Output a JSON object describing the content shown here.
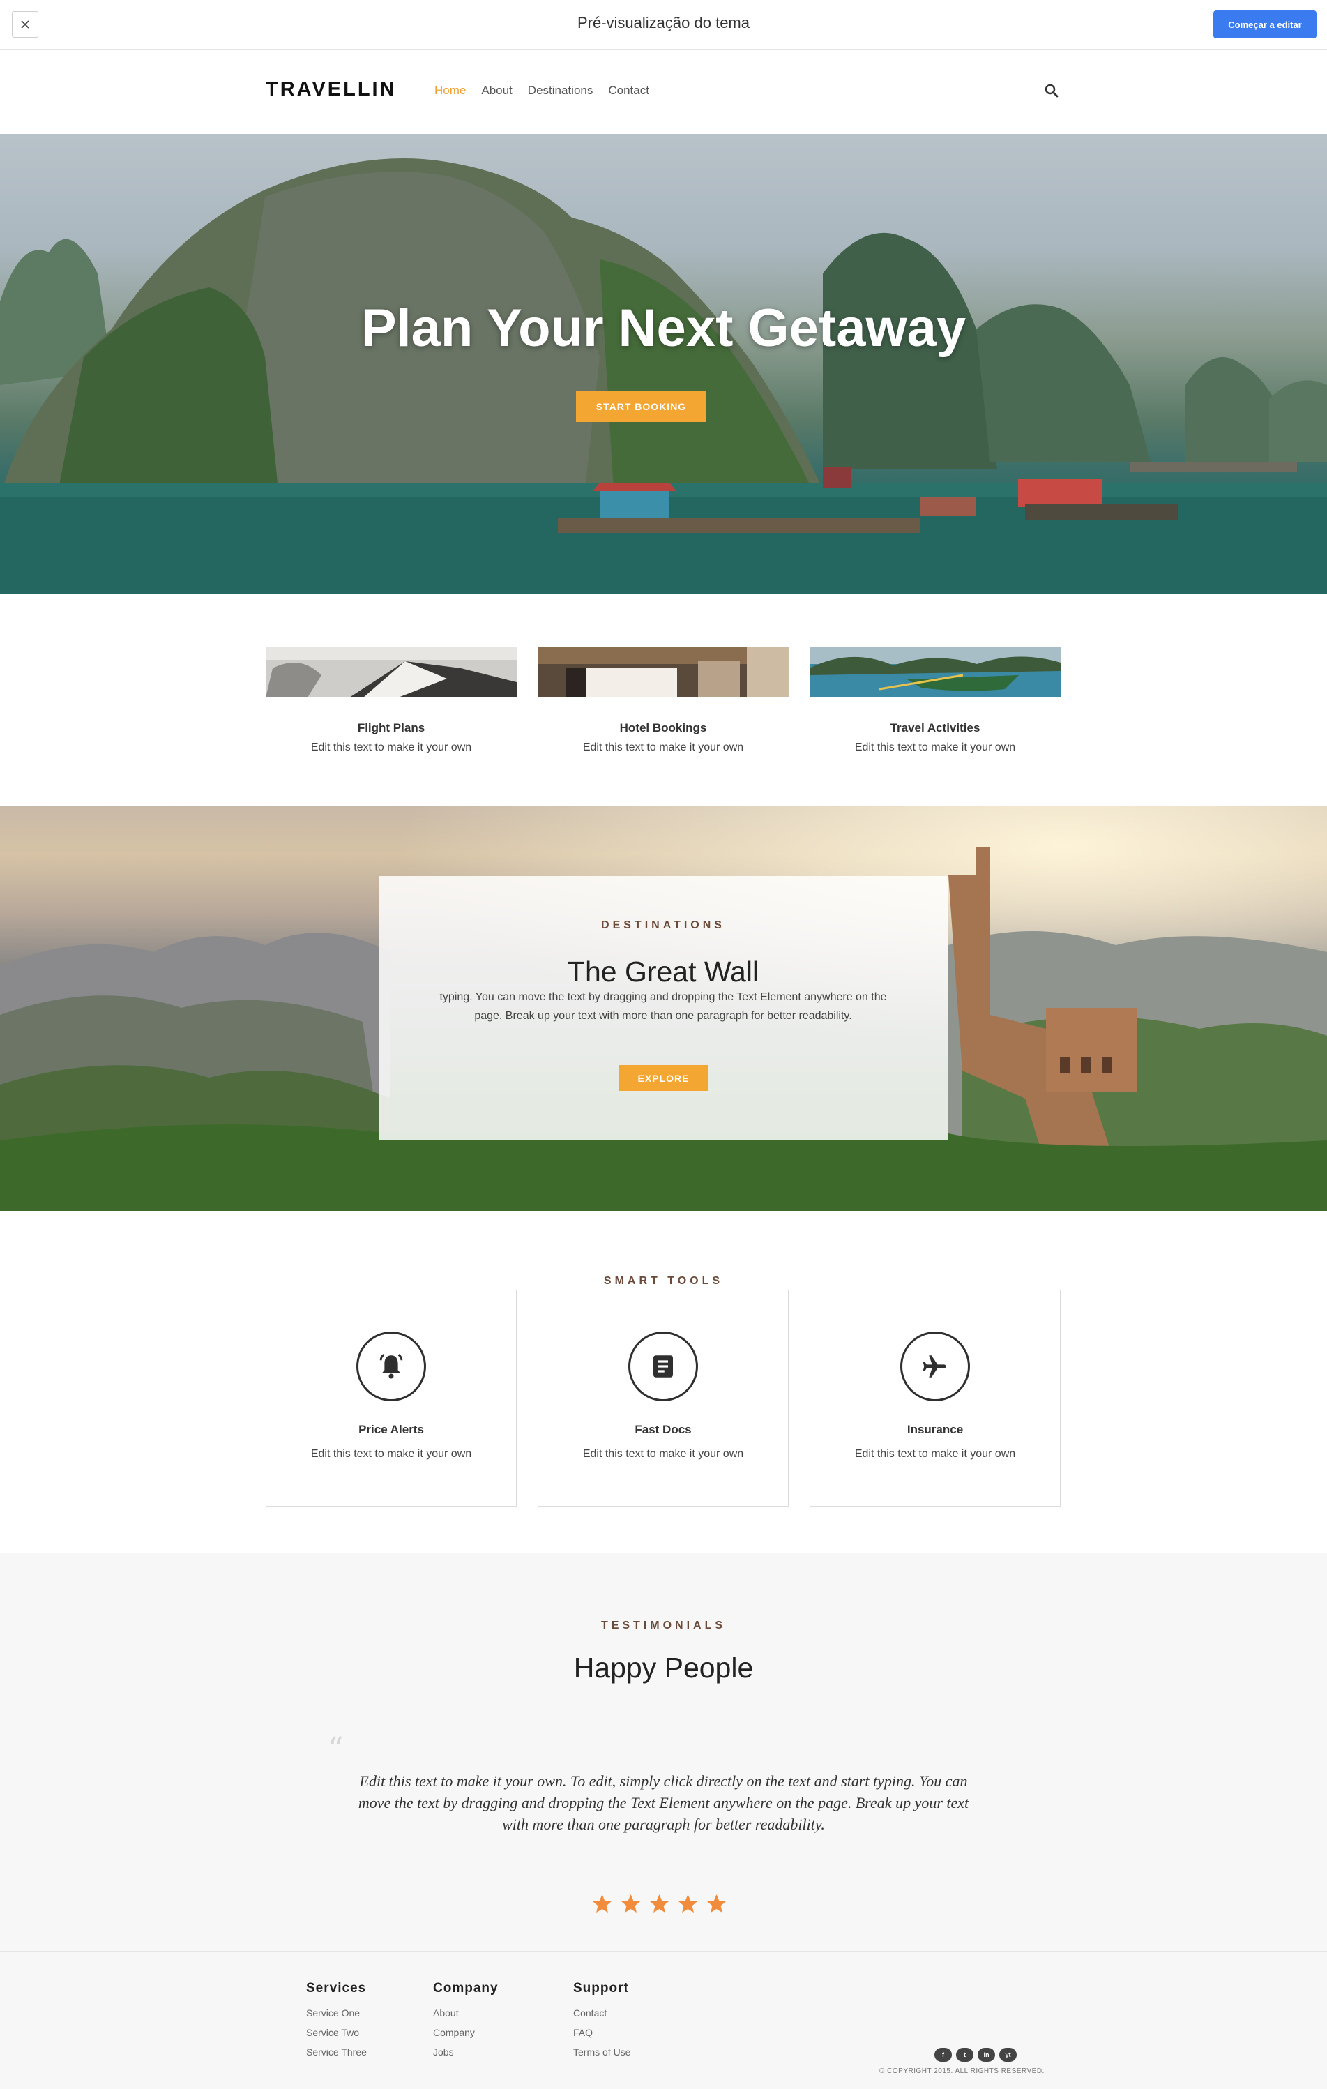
{
  "preview_bar": {
    "title": "Pré-visualização do tema",
    "edit_label": "Começar a editar",
    "close_icon": "close-icon"
  },
  "site": {
    "logo": "TRAVELLIN",
    "nav": [
      {
        "label": "Home",
        "active": true
      },
      {
        "label": "About",
        "active": false
      },
      {
        "label": "Destinations",
        "active": false
      },
      {
        "label": "Contact",
        "active": false
      }
    ],
    "search_icon": "search-icon",
    "accent_color": "#f4a632"
  },
  "hero": {
    "title": "Plan Your Next Getaway",
    "button": "START BOOKING"
  },
  "services": [
    {
      "title": "Flight Plans",
      "desc": "Edit this text to make it your own"
    },
    {
      "title": "Hotel Bookings",
      "desc": "Edit this text to make it your own"
    },
    {
      "title": "Travel Activities",
      "desc": "Edit this text to make it your own"
    }
  ],
  "destinations": {
    "eyebrow": "DESTINATIONS",
    "title": "The Great Wall",
    "text": "typing. You can move the text by dragging and dropping the Text Element anywhere on the page. Break up your text with more than one paragraph for better readability.",
    "button": "EXPLORE"
  },
  "tools": {
    "eyebrow": "SMART TOOLS",
    "items": [
      {
        "title": "Price Alerts",
        "desc": "Edit this text to make it your own",
        "icon": "bell-icon"
      },
      {
        "title": "Fast Docs",
        "desc": "Edit this text to make it your own",
        "icon": "document-icon"
      },
      {
        "title": "Insurance",
        "desc": "Edit this text to make it your own",
        "icon": "airplane-icon"
      }
    ]
  },
  "testimonials": {
    "eyebrow": "TESTIMONIALS",
    "title": "Happy People",
    "quote": "Edit this text to make it your own. To edit, simply click directly on the text and start typing. You can move the text by dragging and dropping the Text Element anywhere on the page. Break up your text with more than one paragraph for better readability.",
    "rating": 5,
    "star_color": "#f08c3c"
  },
  "footer": {
    "columns": [
      {
        "heading": "Services",
        "links": [
          "Service One",
          "Service Two",
          "Service Three"
        ]
      },
      {
        "heading": "Company",
        "links": [
          "About",
          "Company",
          "Jobs"
        ]
      },
      {
        "heading": "Support",
        "links": [
          "Contact",
          "FAQ",
          "Terms of Use"
        ]
      }
    ],
    "social": [
      "f",
      "t",
      "in",
      "yt"
    ],
    "copyright": "© COPYRIGHT 2015. ALL RIGHTS RESERVED."
  }
}
